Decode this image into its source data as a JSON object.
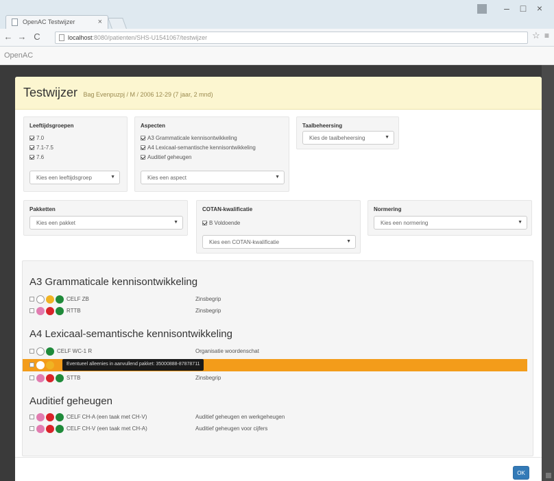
{
  "browser": {
    "tab_title": "OpenAC Testwijzer",
    "url_host": "localhost",
    "url_rest": ":8080/patienten/SHS-U1541067/testwijzer"
  },
  "app": {
    "title": "OpenAC"
  },
  "modal": {
    "title": "Testwijzer",
    "subtitle": "Bag Evenpuzpj / M / 2006 12-29 (7 jaar, 2 mnd)",
    "leeftijd": {
      "title": "Leeftijdsgroepen",
      "items": [
        "7.0",
        "7.1-7.5",
        "7.6"
      ],
      "select": "Kies een leeftijdsgroep"
    },
    "aspecten": {
      "title": "Aspecten",
      "items": [
        "A3 Grammaticale kennisontwikkeling",
        "A4 Lexicaal-semantische kennisontwikkeling",
        "Auditief geheugen"
      ],
      "select": "Kies een aspect"
    },
    "taalbeheersing": {
      "title": "Taalbeheersing",
      "select": "Kies de taalbeheersing"
    },
    "pakketten": {
      "title": "Pakketten",
      "select": "Kies een pakket"
    },
    "cotan": {
      "title": "COTAN-kwalificatie",
      "items": [
        "B Voldoende"
      ],
      "select": "Kies een COTAN-kwalificatie"
    },
    "normering": {
      "title": "Normering",
      "select": "Kies een normering"
    },
    "sections": [
      {
        "heading": "A3 Grammaticale kennisontwikkeling",
        "rows": [
          {
            "test": "CELF ZB",
            "aspect": "Zinsbegrip"
          },
          {
            "test": "RTTB",
            "aspect": "Zinsbegrip"
          }
        ]
      },
      {
        "heading": "A4 Lexicaal-semantische kennisontwikkeling",
        "rows": [
          {
            "test": "CELF WC-1 R",
            "aspect": "Organisatie woordenschat"
          },
          {
            "test": "",
            "aspect": ""
          },
          {
            "test": "STTB",
            "aspect": "Zinsbegrip"
          }
        ]
      },
      {
        "heading": "Auditief geheugen",
        "rows": [
          {
            "test": "CELF CH-A (een taak met CH-V)",
            "aspect": "Auditief geheugen en werkgeheugen"
          },
          {
            "test": "CELF CH-V (een taak met CH-A)",
            "aspect": "Auditief geheugen voor cijfers"
          }
        ]
      }
    ],
    "tooltip": "Eventueel alleenies in aanvullend pakket: 35000888-87878711",
    "ok_label": "OK"
  },
  "colors": {
    "white": "#ffffff",
    "yellow": "#f0b323",
    "pink": "#e27cb0",
    "red": "#d9232a",
    "green": "#1f8a3a",
    "highlight": "#f39c1a",
    "ok": "#337ab7"
  }
}
